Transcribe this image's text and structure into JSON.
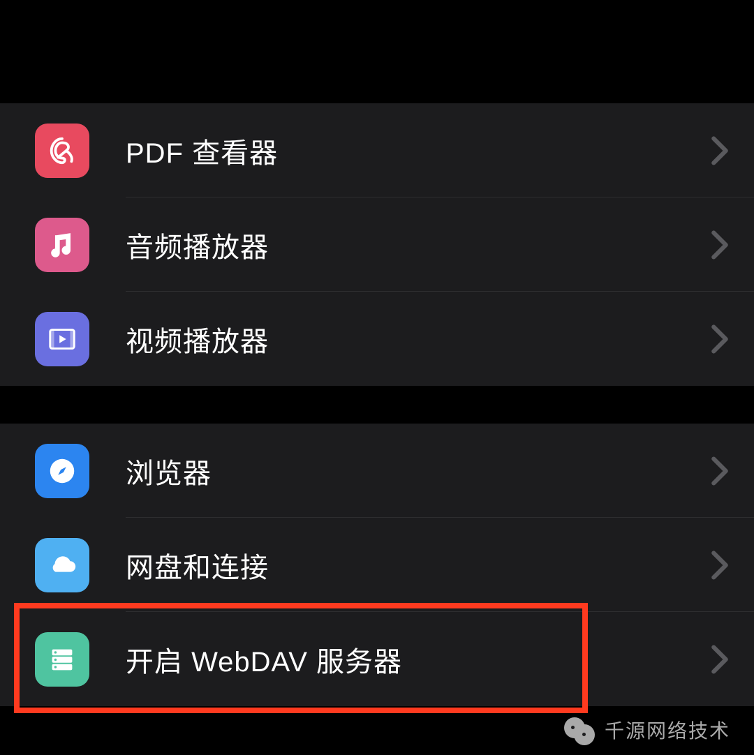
{
  "sections": [
    {
      "rows": [
        {
          "label": "PDF 查看器",
          "icon": "pdf-icon",
          "bg": "bg-pdf"
        },
        {
          "label": "音频播放器",
          "icon": "music-icon",
          "bg": "bg-audio"
        },
        {
          "label": "视频播放器",
          "icon": "video-icon",
          "bg": "bg-video"
        }
      ]
    },
    {
      "rows": [
        {
          "label": "浏览器",
          "icon": "compass-icon",
          "bg": "bg-browser"
        },
        {
          "label": "网盘和连接",
          "icon": "cloud-icon",
          "bg": "bg-cloud"
        },
        {
          "label": "开启 WebDAV 服务器",
          "icon": "server-icon",
          "bg": "bg-server"
        }
      ]
    }
  ],
  "watermark": "千源网络技术"
}
